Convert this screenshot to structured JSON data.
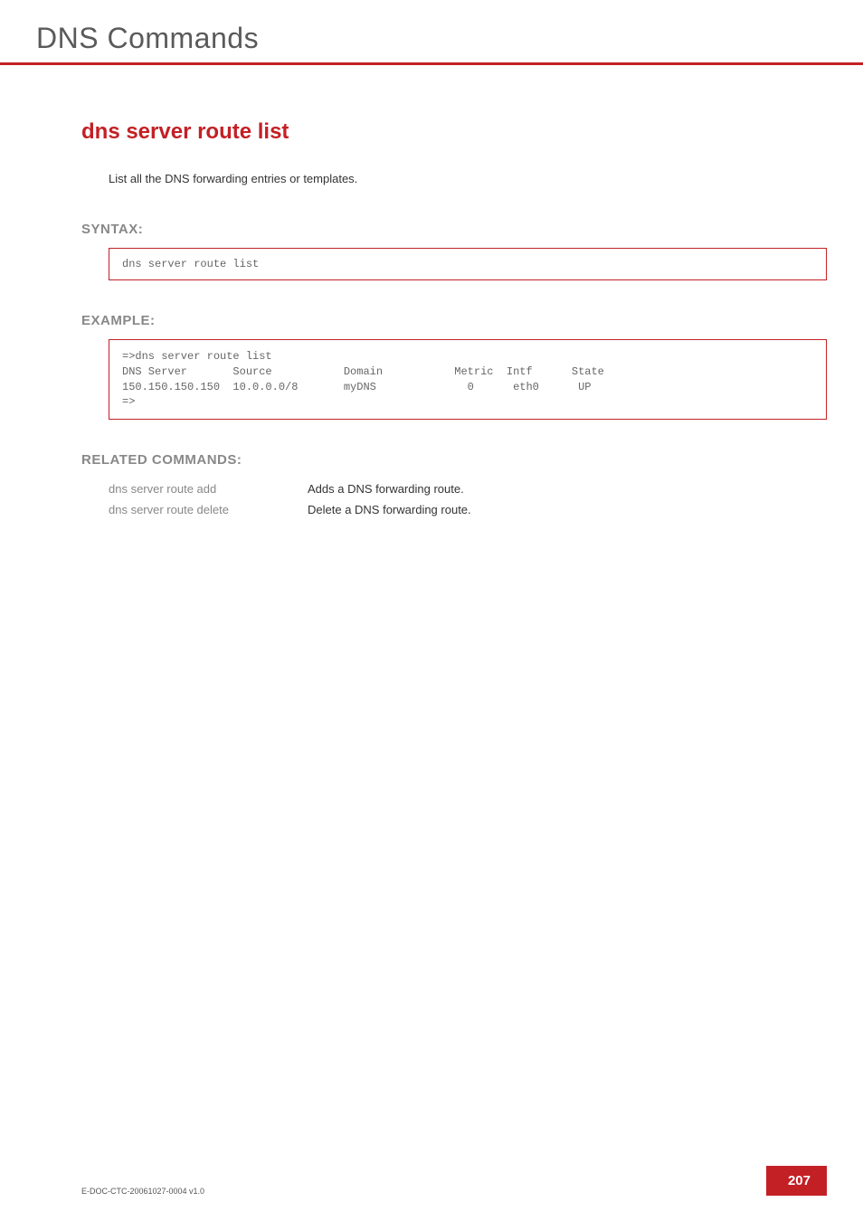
{
  "header": {
    "chapter_title": "DNS Commands"
  },
  "command": {
    "title": "dns server route list",
    "description": "List all the DNS forwarding entries or templates."
  },
  "syntax": {
    "label": "SYNTAX:",
    "code": "dns server route list"
  },
  "example": {
    "label": "EXAMPLE:",
    "output": "=>dns server route list\nDNS Server       Source           Domain           Metric  Intf      State\n150.150.150.150  10.0.0.0/8       myDNS              0      eth0      UP\n=>"
  },
  "related": {
    "label": "RELATED COMMANDS:",
    "rows": [
      {
        "cmd": "dns server route add",
        "desc": "Adds a DNS forwarding route."
      },
      {
        "cmd": "dns server route delete",
        "desc": "Delete a DNS forwarding route."
      }
    ]
  },
  "footer": {
    "doc_id": "E-DOC-CTC-20061027-0004 v1.0",
    "page_number": "207"
  }
}
